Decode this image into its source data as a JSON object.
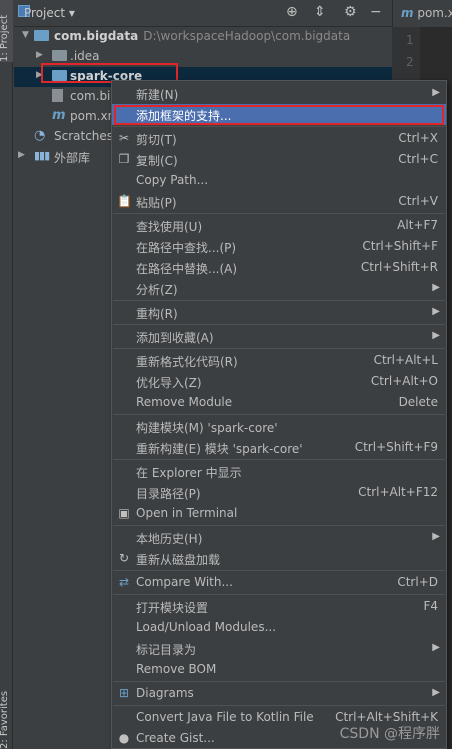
{
  "sidebar": {
    "project_tab": "1: Project",
    "favorites_tab": "2: Favorites"
  },
  "header": {
    "title": "Project",
    "editor_tab": "pom.xml"
  },
  "gutter": {
    "lines": [
      "1",
      "2"
    ]
  },
  "tree": {
    "root": {
      "label": "com.bigdata",
      "path": "D:\\workspaceHadoop\\com.bigdata"
    },
    "idea": "idea",
    "spark_core": "spark-core",
    "com_bi": "com.bi",
    "pom": "pom.xn",
    "scratches": "Scratches",
    "external": "外部库"
  },
  "menu": {
    "new": {
      "label": "新建(N)"
    },
    "add_framework": {
      "label": "添加框架的支持..."
    },
    "cut": {
      "label": "剪切(T)",
      "shortcut": "Ctrl+X"
    },
    "copy": {
      "label": "复制(C)",
      "shortcut": "Ctrl+C"
    },
    "copy_path": {
      "label": "Copy Path..."
    },
    "paste": {
      "label": "粘贴(P)",
      "shortcut": "Ctrl+V"
    },
    "find_usages": {
      "label": "查找使用(U)",
      "shortcut": "Alt+F7"
    },
    "find_in_path": {
      "label": "在路径中查找...(P)",
      "shortcut": "Ctrl+Shift+F"
    },
    "replace_in_path": {
      "label": "在路径中替换...(A)",
      "shortcut": "Ctrl+Shift+R"
    },
    "analyze": {
      "label": "分析(Z)"
    },
    "refactor": {
      "label": "重构(R)"
    },
    "add_favorites": {
      "label": "添加到收藏(A)"
    },
    "reformat": {
      "label": "重新格式化代码(R)",
      "shortcut": "Ctrl+Alt+L"
    },
    "optimize_imports": {
      "label": "优化导入(Z)",
      "shortcut": "Ctrl+Alt+O"
    },
    "remove_module": {
      "label": "Remove Module",
      "shortcut": "Delete"
    },
    "build_module": {
      "label": "构建模块(M) 'spark-core'"
    },
    "rebuild_module": {
      "label": "重新构建(E) 模块 'spark-core'",
      "shortcut": "Ctrl+Shift+F9"
    },
    "show_explorer": {
      "label": "在 Explorer 中显示"
    },
    "dir_path": {
      "label": "目录路径(P)",
      "shortcut": "Ctrl+Alt+F12"
    },
    "open_terminal": {
      "label": "Open in Terminal"
    },
    "local_history": {
      "label": "本地历史(H)"
    },
    "reload_disk": {
      "label": "重新从磁盘加载"
    },
    "compare_with": {
      "label": "Compare With...",
      "shortcut": "Ctrl+D"
    },
    "module_settings": {
      "label": "打开模块设置",
      "shortcut": "F4"
    },
    "load_unload": {
      "label": "Load/Unload Modules..."
    },
    "mark_dir": {
      "label": "标记目录为"
    },
    "remove_bom": {
      "label": "Remove BOM"
    },
    "diagrams": {
      "label": "Diagrams"
    },
    "convert_kotlin": {
      "label": "Convert Java File to Kotlin File",
      "shortcut": "Ctrl+Alt+Shift+K"
    },
    "create_gist": {
      "label": "Create Gist..."
    }
  },
  "watermark": "CSDN @程序胖"
}
